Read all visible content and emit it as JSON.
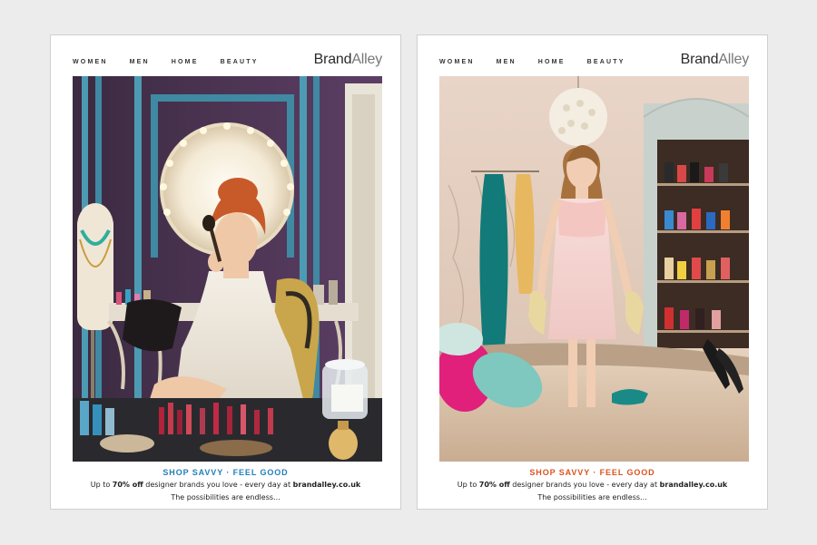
{
  "colors": {
    "tagline_left": "#1f7fb8",
    "tagline_right": "#d9541e",
    "background": "#ececec"
  },
  "ads": [
    {
      "nav": [
        "WOMEN",
        "MEN",
        "HOME",
        "BEAUTY"
      ],
      "logo_first": "Brand",
      "logo_second": "Alley",
      "tagline": "SHOP SAVVY · FEEL GOOD",
      "sub_prefix": "Up to ",
      "sub_highlight": "70% off",
      "sub_middle": " designer brands you love - every day at ",
      "sub_site": "brandalley.co.uk",
      "closing": "The possibilities are endless..."
    },
    {
      "nav": [
        "WOMEN",
        "MEN",
        "HOME",
        "BEAUTY"
      ],
      "logo_first": "Brand",
      "logo_second": "Alley",
      "tagline": "SHOP SAVVY · FEEL GOOD",
      "sub_prefix": "Up to ",
      "sub_highlight": "70% off",
      "sub_middle": " designer brands you love - every day at ",
      "sub_site": "brandalley.co.uk",
      "closing": "The possibilities are endless..."
    }
  ]
}
